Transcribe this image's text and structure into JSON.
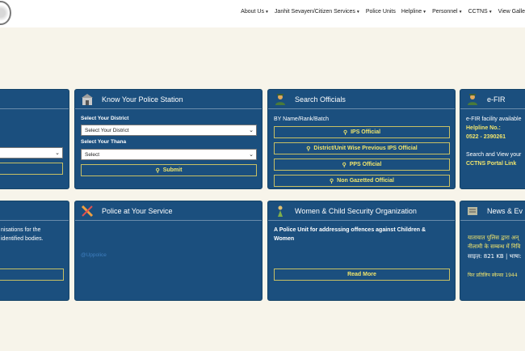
{
  "nav": {
    "items": [
      {
        "label": "About Us",
        "caret": true
      },
      {
        "label": "Janhit Sevayen/Citizen Services",
        "caret": true
      },
      {
        "label": "Police Units",
        "caret": false
      },
      {
        "label": "Helpline",
        "caret": true
      },
      {
        "label": "Personnel",
        "caret": true
      },
      {
        "label": "CCTNS",
        "caret": true
      },
      {
        "label": "View Galle",
        "caret": false
      }
    ]
  },
  "colors": {
    "card_bg": "#1b4f7e",
    "accent_yellow": "#f1e56c",
    "page_bg": "#f7f4ea"
  },
  "left_top": {
    "select_value": "",
    "button": ""
  },
  "police_station": {
    "title": "Know Your Police Station",
    "icon": "police-station-icon",
    "district_label": "Select Your District",
    "district_value": "Select Your District",
    "thana_label": "Select Your Thana",
    "thana_value": "Select",
    "submit": "Submit"
  },
  "search_officials": {
    "title": "Search Officials",
    "icon": "officer-icon",
    "subtitle": "BY Name/Rank/Batch",
    "buttons": [
      "IPS Official",
      "District/Unit Wise Previous IPS Official",
      "PPS Official",
      "Non Gazetted Official"
    ]
  },
  "efir": {
    "title": "e-FIR",
    "icon": "officer-icon",
    "line1": "e-FIR facility available",
    "helpline_label": "Helpline No.:",
    "helpline_number": "0522 - 2390261",
    "line2": "Search and View your",
    "link": "CCTNS Portal Link"
  },
  "left_bottom": {
    "line1": "nisations for the",
    "line2": "identified bodies."
  },
  "police_service": {
    "title": "Police at Your Service",
    "icon": "x-twitter-icon",
    "handle": "@Uppolice"
  },
  "women_child": {
    "title": "Women & Child Security Organization",
    "icon": "women-icon",
    "description": "A Police Unit for addressing offences against Children & Women",
    "read_more": "Read More"
  },
  "news": {
    "title": "News & Ev",
    "icon": "news-icon",
    "line1": "यातायात पुलिस द्वारा अन्",
    "line2": "नीलामी के सम्बन्ध में निवि",
    "size": "साइज़: 821 KB | भाषा:",
    "line3": "फिर प्रतिलिप स्केन्सा 1944"
  }
}
